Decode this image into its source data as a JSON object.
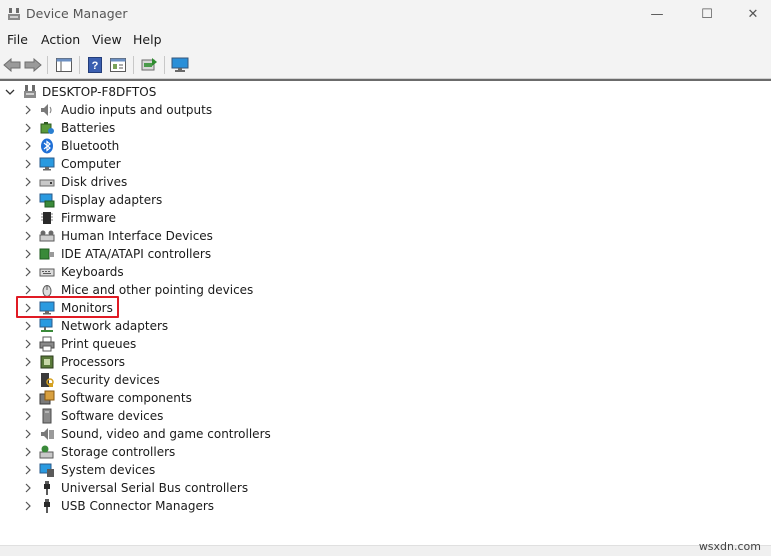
{
  "window": {
    "title": "Device Manager",
    "minimize": "—",
    "maximize": "☐",
    "close": "✕"
  },
  "menu": {
    "items": [
      {
        "label": "File"
      },
      {
        "label": "Action"
      },
      {
        "label": "View"
      },
      {
        "label": "Help"
      }
    ]
  },
  "toolbar": {
    "buttons": [
      "back-icon",
      "forward-icon",
      "show-hide-console-tree-icon",
      "help-icon",
      "properties-icon",
      "update-driver-icon",
      "scan-hardware-icon"
    ]
  },
  "tree": {
    "root": {
      "label": "DESKTOP-F8DFTOS",
      "expanded": true
    },
    "categories": [
      {
        "label": "Audio inputs and outputs",
        "icon": "speaker-icon"
      },
      {
        "label": "Batteries",
        "icon": "battery-icon"
      },
      {
        "label": "Bluetooth",
        "icon": "bluetooth-icon"
      },
      {
        "label": "Computer",
        "icon": "computer-icon"
      },
      {
        "label": "Disk drives",
        "icon": "disk-drive-icon"
      },
      {
        "label": "Display adapters",
        "icon": "display-adapter-icon"
      },
      {
        "label": "Firmware",
        "icon": "firmware-icon"
      },
      {
        "label": "Human Interface Devices",
        "icon": "hid-icon"
      },
      {
        "label": "IDE ATA/ATAPI controllers",
        "icon": "ide-controller-icon"
      },
      {
        "label": "Keyboards",
        "icon": "keyboard-icon"
      },
      {
        "label": "Mice and other pointing devices",
        "icon": "mouse-icon"
      },
      {
        "label": "Monitors",
        "icon": "monitor-icon",
        "highlighted": true
      },
      {
        "label": "Network adapters",
        "icon": "network-adapter-icon"
      },
      {
        "label": "Print queues",
        "icon": "printer-icon"
      },
      {
        "label": "Processors",
        "icon": "processor-icon"
      },
      {
        "label": "Security devices",
        "icon": "security-device-icon"
      },
      {
        "label": "Software components",
        "icon": "software-component-icon"
      },
      {
        "label": "Software devices",
        "icon": "software-device-icon"
      },
      {
        "label": "Sound, video and game controllers",
        "icon": "sound-controller-icon"
      },
      {
        "label": "Storage controllers",
        "icon": "storage-controller-icon"
      },
      {
        "label": "System devices",
        "icon": "system-devices-icon"
      },
      {
        "label": "Universal Serial Bus controllers",
        "icon": "usb-controller-icon"
      },
      {
        "label": "USB Connector Managers",
        "icon": "usb-connector-icon"
      }
    ]
  },
  "colors": {
    "highlight_border": "#e01b24",
    "chrome_bg": "#f3f3f3"
  },
  "watermark": "wsxdn.com"
}
